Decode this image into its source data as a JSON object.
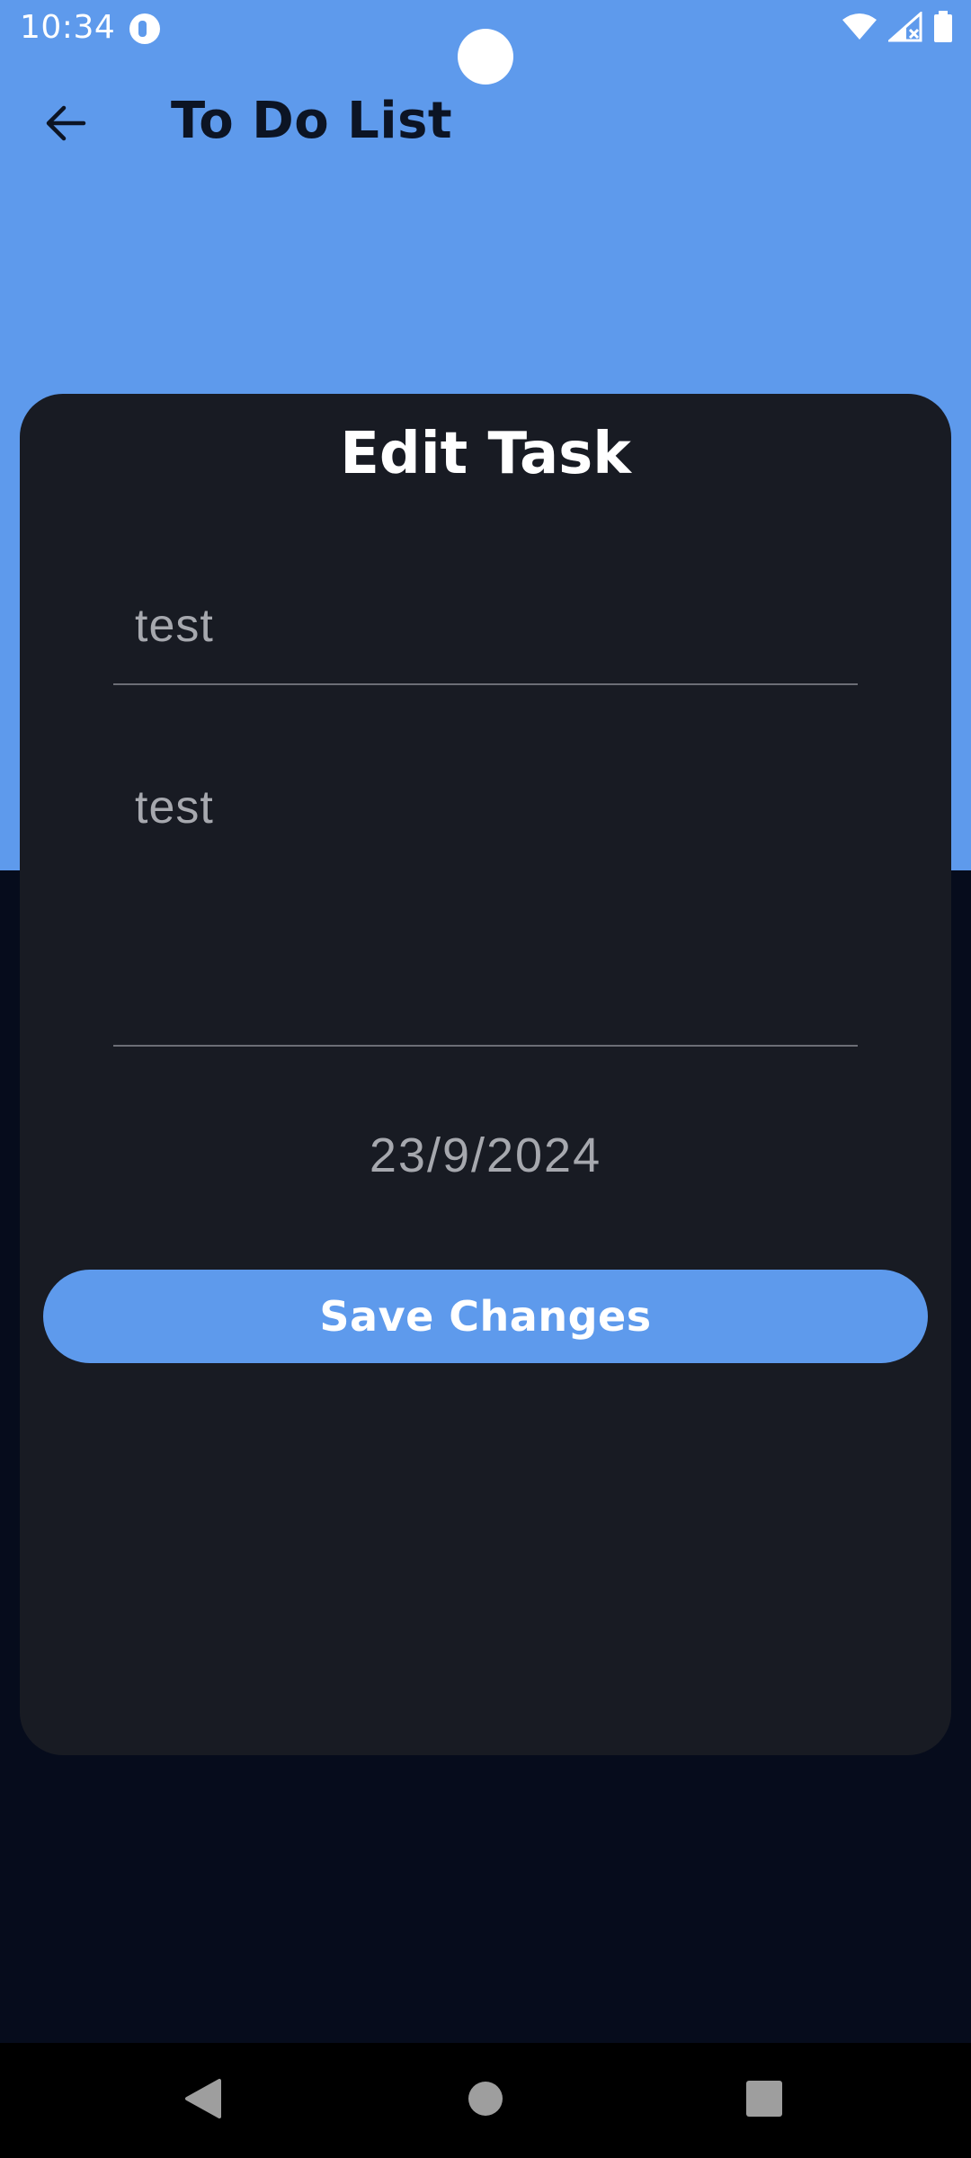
{
  "status_bar": {
    "time": "10:34"
  },
  "app_bar": {
    "title": "To Do List"
  },
  "edit_card": {
    "title": "Edit Task",
    "task_title_value": "test",
    "task_description_value": "test",
    "date": "23/9/2024",
    "save_label": "Save Changes"
  },
  "colors": {
    "primary": "#5e9aec",
    "card_background": "#181b23",
    "page_background": "#060c1c"
  },
  "icons": {
    "back": "arrow-left-icon",
    "wifi": "wifi-icon",
    "signal": "signal-icon",
    "battery": "battery-icon",
    "nav_back": "triangle-back-icon",
    "nav_home": "circle-home-icon",
    "nav_recent": "square-recents-icon"
  }
}
